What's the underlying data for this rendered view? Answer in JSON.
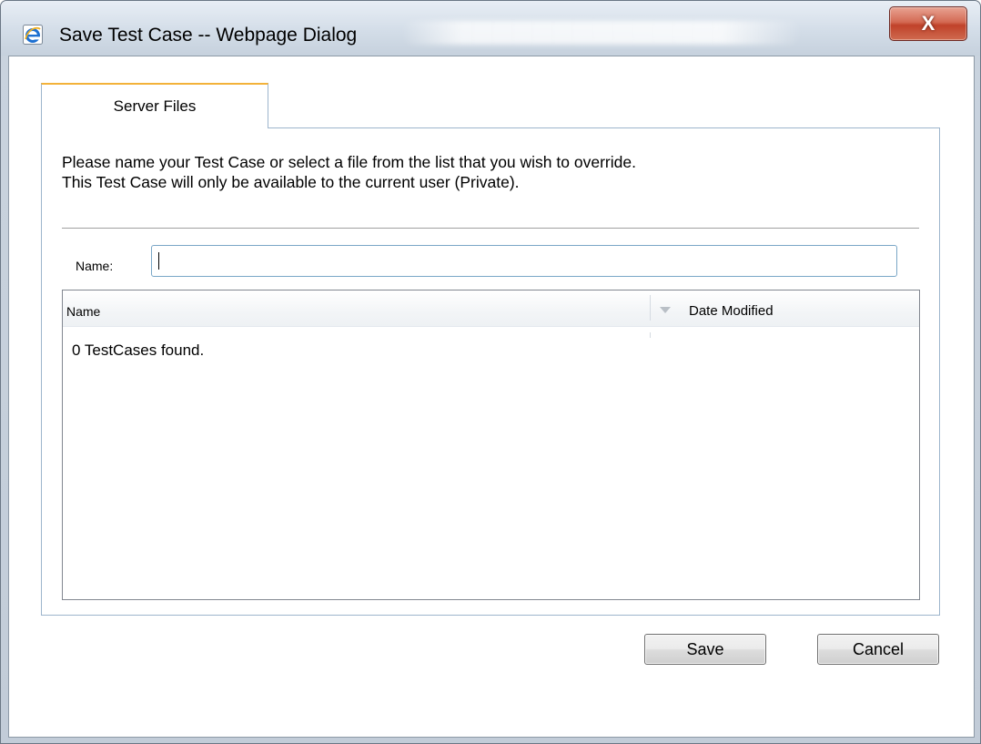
{
  "window": {
    "title": "Save Test Case -- Webpage Dialog",
    "close_glyph": "X",
    "icon": "internet-explorer-icon"
  },
  "tabs": [
    {
      "label": "Server Files",
      "active": true
    }
  ],
  "instructions": {
    "line1": "Please name your Test Case or select a file from the list that you wish to override.",
    "line2": "This Test Case will only be available to the current user (Private)."
  },
  "name_field": {
    "label": "Name:",
    "value": ""
  },
  "file_list": {
    "columns": [
      "Name",
      "Date Modified"
    ],
    "sort_indicator": "sort-descending-icon",
    "empty_message": "0 TestCases found."
  },
  "buttons": {
    "save": "Save",
    "cancel": "Cancel"
  },
  "colors": {
    "tab_accent": "#f3b23a",
    "close_button": "#c0422a",
    "input_border": "#7aa7c7"
  }
}
